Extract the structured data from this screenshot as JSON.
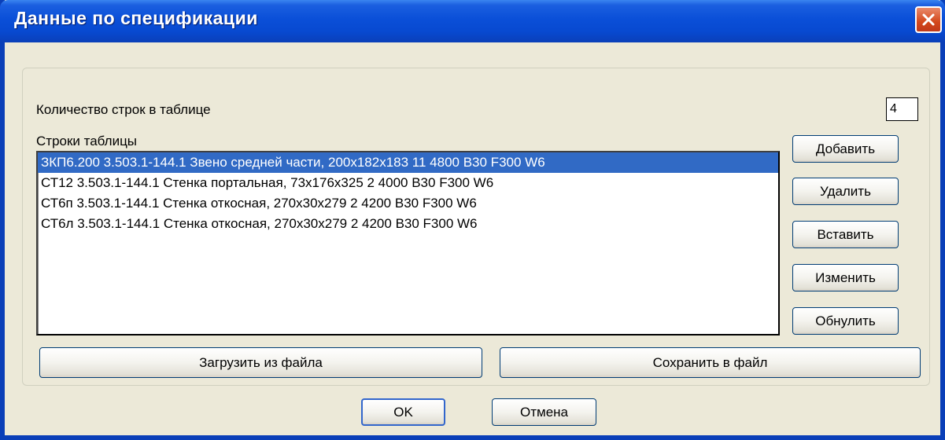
{
  "window": {
    "title": "Данные по спецификации"
  },
  "row_count": {
    "label": "Количество строк в таблице",
    "value": "4"
  },
  "table_rows": {
    "label": "Строки таблицы",
    "items": [
      "ЗКП6.200 3.503.1-144.1  Звено средней части, 200x182x183 11 4800 B30 F300 W6",
      "СТ12 3.503.1-144.1  Стенка портальная, 73x176x325 2 4000 B30 F300 W6",
      "СТ6п 3.503.1-144.1  Стенка откосная, 270x30x279 2 4200 B30 F300 W6",
      "СТ6л 3.503.1-144.1  Стенка откосная, 270x30x279 2 4200 B30 F300 W6"
    ],
    "selected_index": 0
  },
  "buttons": {
    "add": "Добавить",
    "delete": "Удалить",
    "insert": "Вставить",
    "edit": "Изменить",
    "reset": "Обнулить",
    "load": "Загрузить из файла",
    "save": "Сохранить в файл",
    "ok": "OK",
    "cancel": "Отмена"
  },
  "icons": {
    "close": "close-icon"
  },
  "colors": {
    "titlebar": "#0a4fd8",
    "selection": "#316ac5",
    "close_button": "#d3481c"
  }
}
